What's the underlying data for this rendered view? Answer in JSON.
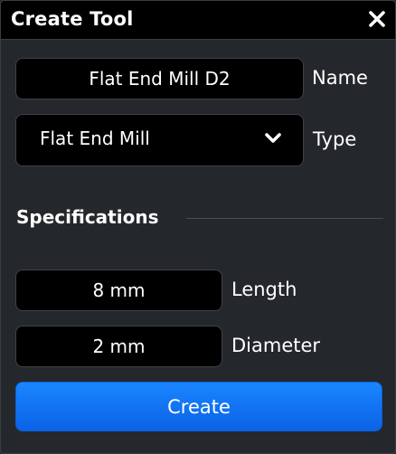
{
  "window": {
    "title": "Create Tool",
    "close_icon": "close-icon"
  },
  "form": {
    "name": {
      "value": "Flat End Mill D2",
      "label": "Name"
    },
    "type": {
      "selected": "Flat End Mill",
      "label": "Type",
      "icon": "chevron-down-icon"
    }
  },
  "specifications": {
    "title": "Specifications",
    "length": {
      "value": "8 mm",
      "label": "Length"
    },
    "diameter": {
      "value": "2 mm",
      "label": "Diameter"
    }
  },
  "actions": {
    "create_label": "Create"
  },
  "colors": {
    "background": "#24272b",
    "field_background": "#000000",
    "accent": "#1a86ff",
    "text": "#ffffff"
  }
}
